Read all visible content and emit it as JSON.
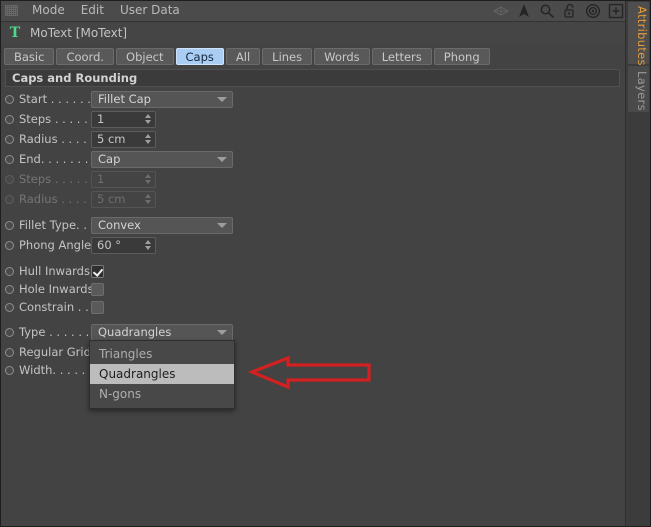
{
  "menubar": {
    "grip_icon": "grip-dots-icon",
    "items": [
      "Mode",
      "Edit",
      "User Data"
    ],
    "icons": [
      {
        "name": "gizmo-diamond-icon",
        "glyph": "diamond"
      },
      {
        "name": "cursor-arrow-icon",
        "glyph": "arrow"
      },
      {
        "name": "search-icon",
        "glyph": "magnifier"
      },
      {
        "name": "unlock-icon",
        "glyph": "padlock-open"
      },
      {
        "name": "target-icon",
        "glyph": "bullseye"
      },
      {
        "name": "add-box-icon",
        "glyph": "plus-box"
      }
    ]
  },
  "object": {
    "icon": "motext-t-icon",
    "icon_glyph": "T",
    "icon_color": "#4fd98a",
    "title": "MoText [MoText]"
  },
  "tabs": {
    "items": [
      {
        "label": "Basic",
        "selected": false
      },
      {
        "label": "Coord.",
        "selected": false
      },
      {
        "label": "Object",
        "selected": false
      },
      {
        "label": "Caps",
        "selected": true
      },
      {
        "label": "All",
        "selected": false
      },
      {
        "label": "Lines",
        "selected": false
      },
      {
        "label": "Words",
        "selected": false
      },
      {
        "label": "Letters",
        "selected": false
      },
      {
        "label": "Phong",
        "selected": false
      }
    ],
    "selected_color": "#aacdf4"
  },
  "group": {
    "header": "Caps and Rounding"
  },
  "params": {
    "start": {
      "label": "Start . . . . . . .",
      "value": "Fillet Cap"
    },
    "start_steps": {
      "label": "Steps . . . . . .",
      "value": "1"
    },
    "start_radius": {
      "label": "Radius . . . . .",
      "value": "5 cm"
    },
    "end": {
      "label": "End. . . . . . . .",
      "value": "Cap"
    },
    "end_steps": {
      "label": "Steps . . . . . .",
      "value": "1"
    },
    "end_radius": {
      "label": "Radius . . . . .",
      "value": "5 cm"
    },
    "fillet_type": {
      "label": "Fillet Type. . .",
      "value": "Convex"
    },
    "phong_angle": {
      "label": "Phong Angle",
      "value": "60 °"
    },
    "hull_inwards": {
      "label": "Hull Inwards",
      "checked": true
    },
    "hole_inwards": {
      "label": "Hole Inwards",
      "checked": false
    },
    "constrain": {
      "label": "Constrain . . .",
      "checked": false
    },
    "type": {
      "label": "Type . . . . . . .",
      "value": "Quadrangles"
    },
    "regular_grid": {
      "label": "Regular Grid"
    },
    "width": {
      "label": "Width. . . . . ."
    }
  },
  "dropdown": {
    "options": [
      {
        "label": "Triangles",
        "selected": false
      },
      {
        "label": "Quadrangles",
        "selected": true
      },
      {
        "label": "N-gons",
        "selected": false
      }
    ]
  },
  "dock": {
    "tabs": [
      {
        "label": "Attributes",
        "active": true,
        "color": "#e59b3c"
      },
      {
        "label": "Layers",
        "active": false,
        "color": "#9a9a9a"
      }
    ]
  },
  "annotation": {
    "arrow_color": "#d32020",
    "points_to": "Quadrangles"
  }
}
